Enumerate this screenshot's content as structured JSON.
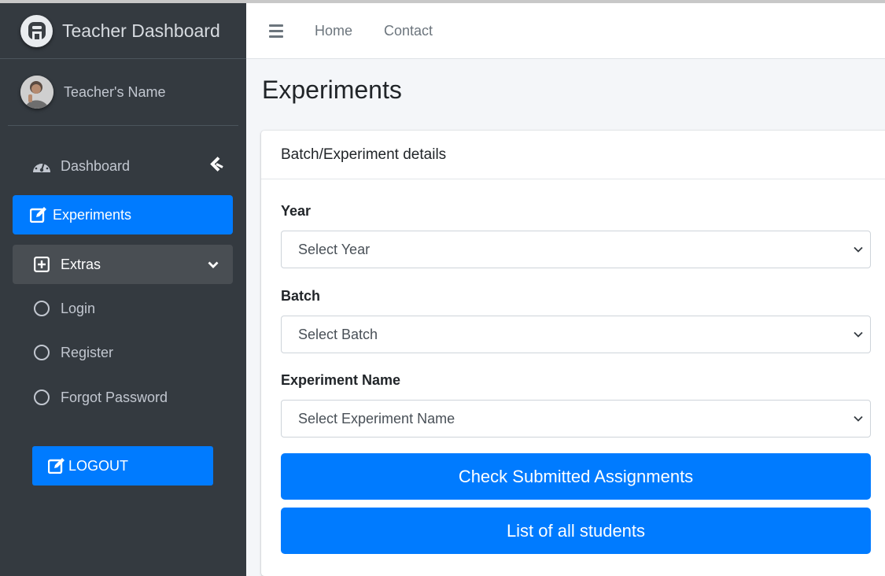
{
  "brand": {
    "title": "Teacher Dashboard"
  },
  "user": {
    "name": "Teacher's Name"
  },
  "sidebar": {
    "items": [
      {
        "label": "Dashboard",
        "icon": "tachometer-icon"
      },
      {
        "label": "Experiments",
        "icon": "edit-icon"
      },
      {
        "label": "Extras",
        "icon": "plus-square-icon"
      },
      {
        "label": "Login",
        "icon": "circle-icon"
      },
      {
        "label": "Register",
        "icon": "circle-icon"
      },
      {
        "label": "Forgot Password",
        "icon": "circle-icon"
      }
    ],
    "logout_label": "LOGOUT"
  },
  "topnav": {
    "home": "Home",
    "contact": "Contact"
  },
  "page": {
    "title": "Experiments"
  },
  "card": {
    "header": "Batch/Experiment details",
    "year_label": "Year",
    "year_value": "Select Year",
    "batch_label": "Batch",
    "batch_value": "Select Batch",
    "experiment_label": "Experiment Name",
    "experiment_value": "Select Experiment Name",
    "check_button": "Check Submitted Assignments",
    "list_button": "List of all students"
  },
  "colors": {
    "accent": "#007bff",
    "sidebar_bg": "#343a40",
    "sidebar_text": "#c2c7d0"
  }
}
